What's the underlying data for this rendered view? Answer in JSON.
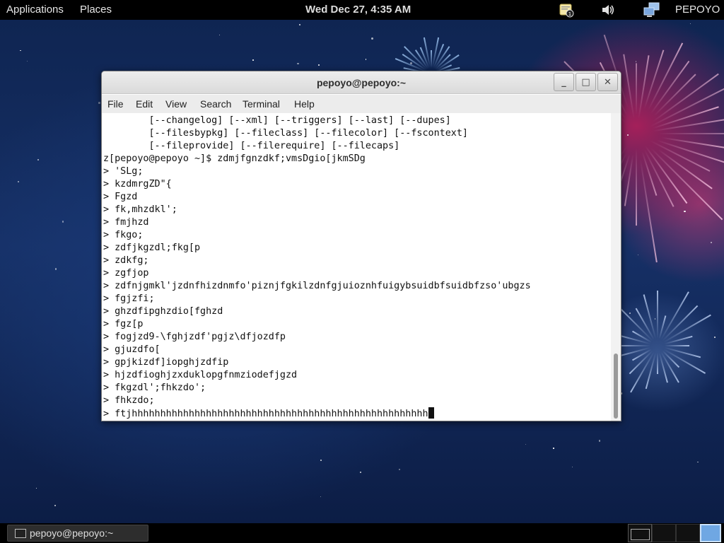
{
  "top_panel": {
    "applications": "Applications",
    "places": "Places",
    "clock": "Wed Dec 27,  4:35 AM",
    "user": "PEPOYO",
    "icons": [
      "notification-icon",
      "volume-icon",
      "network-icon"
    ]
  },
  "window": {
    "title": "pepoyo@pepoyo:~",
    "buttons": {
      "minimize": "_",
      "maximize": "□",
      "close": "✕"
    },
    "menu": [
      "File",
      "Edit",
      "View",
      "Search",
      "Terminal",
      "Help"
    ]
  },
  "terminal": {
    "lines": [
      "        [--changelog] [--xml] [--triggers] [--last] [--dupes]",
      "        [--filesbypkg] [--fileclass] [--filecolor] [--fscontext]",
      "        [--fileprovide] [--filerequire] [--filecaps]",
      "z[pepoyo@pepoyo ~]$ zdmjfgnzdkf;vmsDgio[jkmSDg",
      "> 'SLg;",
      "> kzdmrgZD\"{",
      "> Fgzd",
      "> fk,mhzdkl';",
      "> fmjhzd",
      "> fkgo;",
      "> zdfjkgzdl;fkg[p",
      "> zdkfg;",
      "> zgfjop",
      "> zdfnjgmkl'jzdnfhizdnmfo'piznjfgkilzdnfgjuioznhfuigybsuidbfsuidbfzso'ubgzs",
      "> fgjzfi;",
      "> ghzdfipghzdio[fghzd",
      "> fgz[p",
      "> fogjzd9-\\fghjzdf'pgjz\\dfjozdfp",
      "> gjuzdfo[",
      "> gpjkizdf]iopghjzdfip",
      "> hjzdfioghjzxduklopgfnmziodefjgzd",
      "> fkgzdl';fhkzdo';",
      "> fhkzdo;",
      "> ftjhhhhhhhhhhhhhhhhhhhhhhhhhhhhhhhhhhhhhhhhhhhhhhhhhhhh"
    ]
  },
  "bottom_panel": {
    "task_label": "pepoyo@pepoyo:~"
  }
}
